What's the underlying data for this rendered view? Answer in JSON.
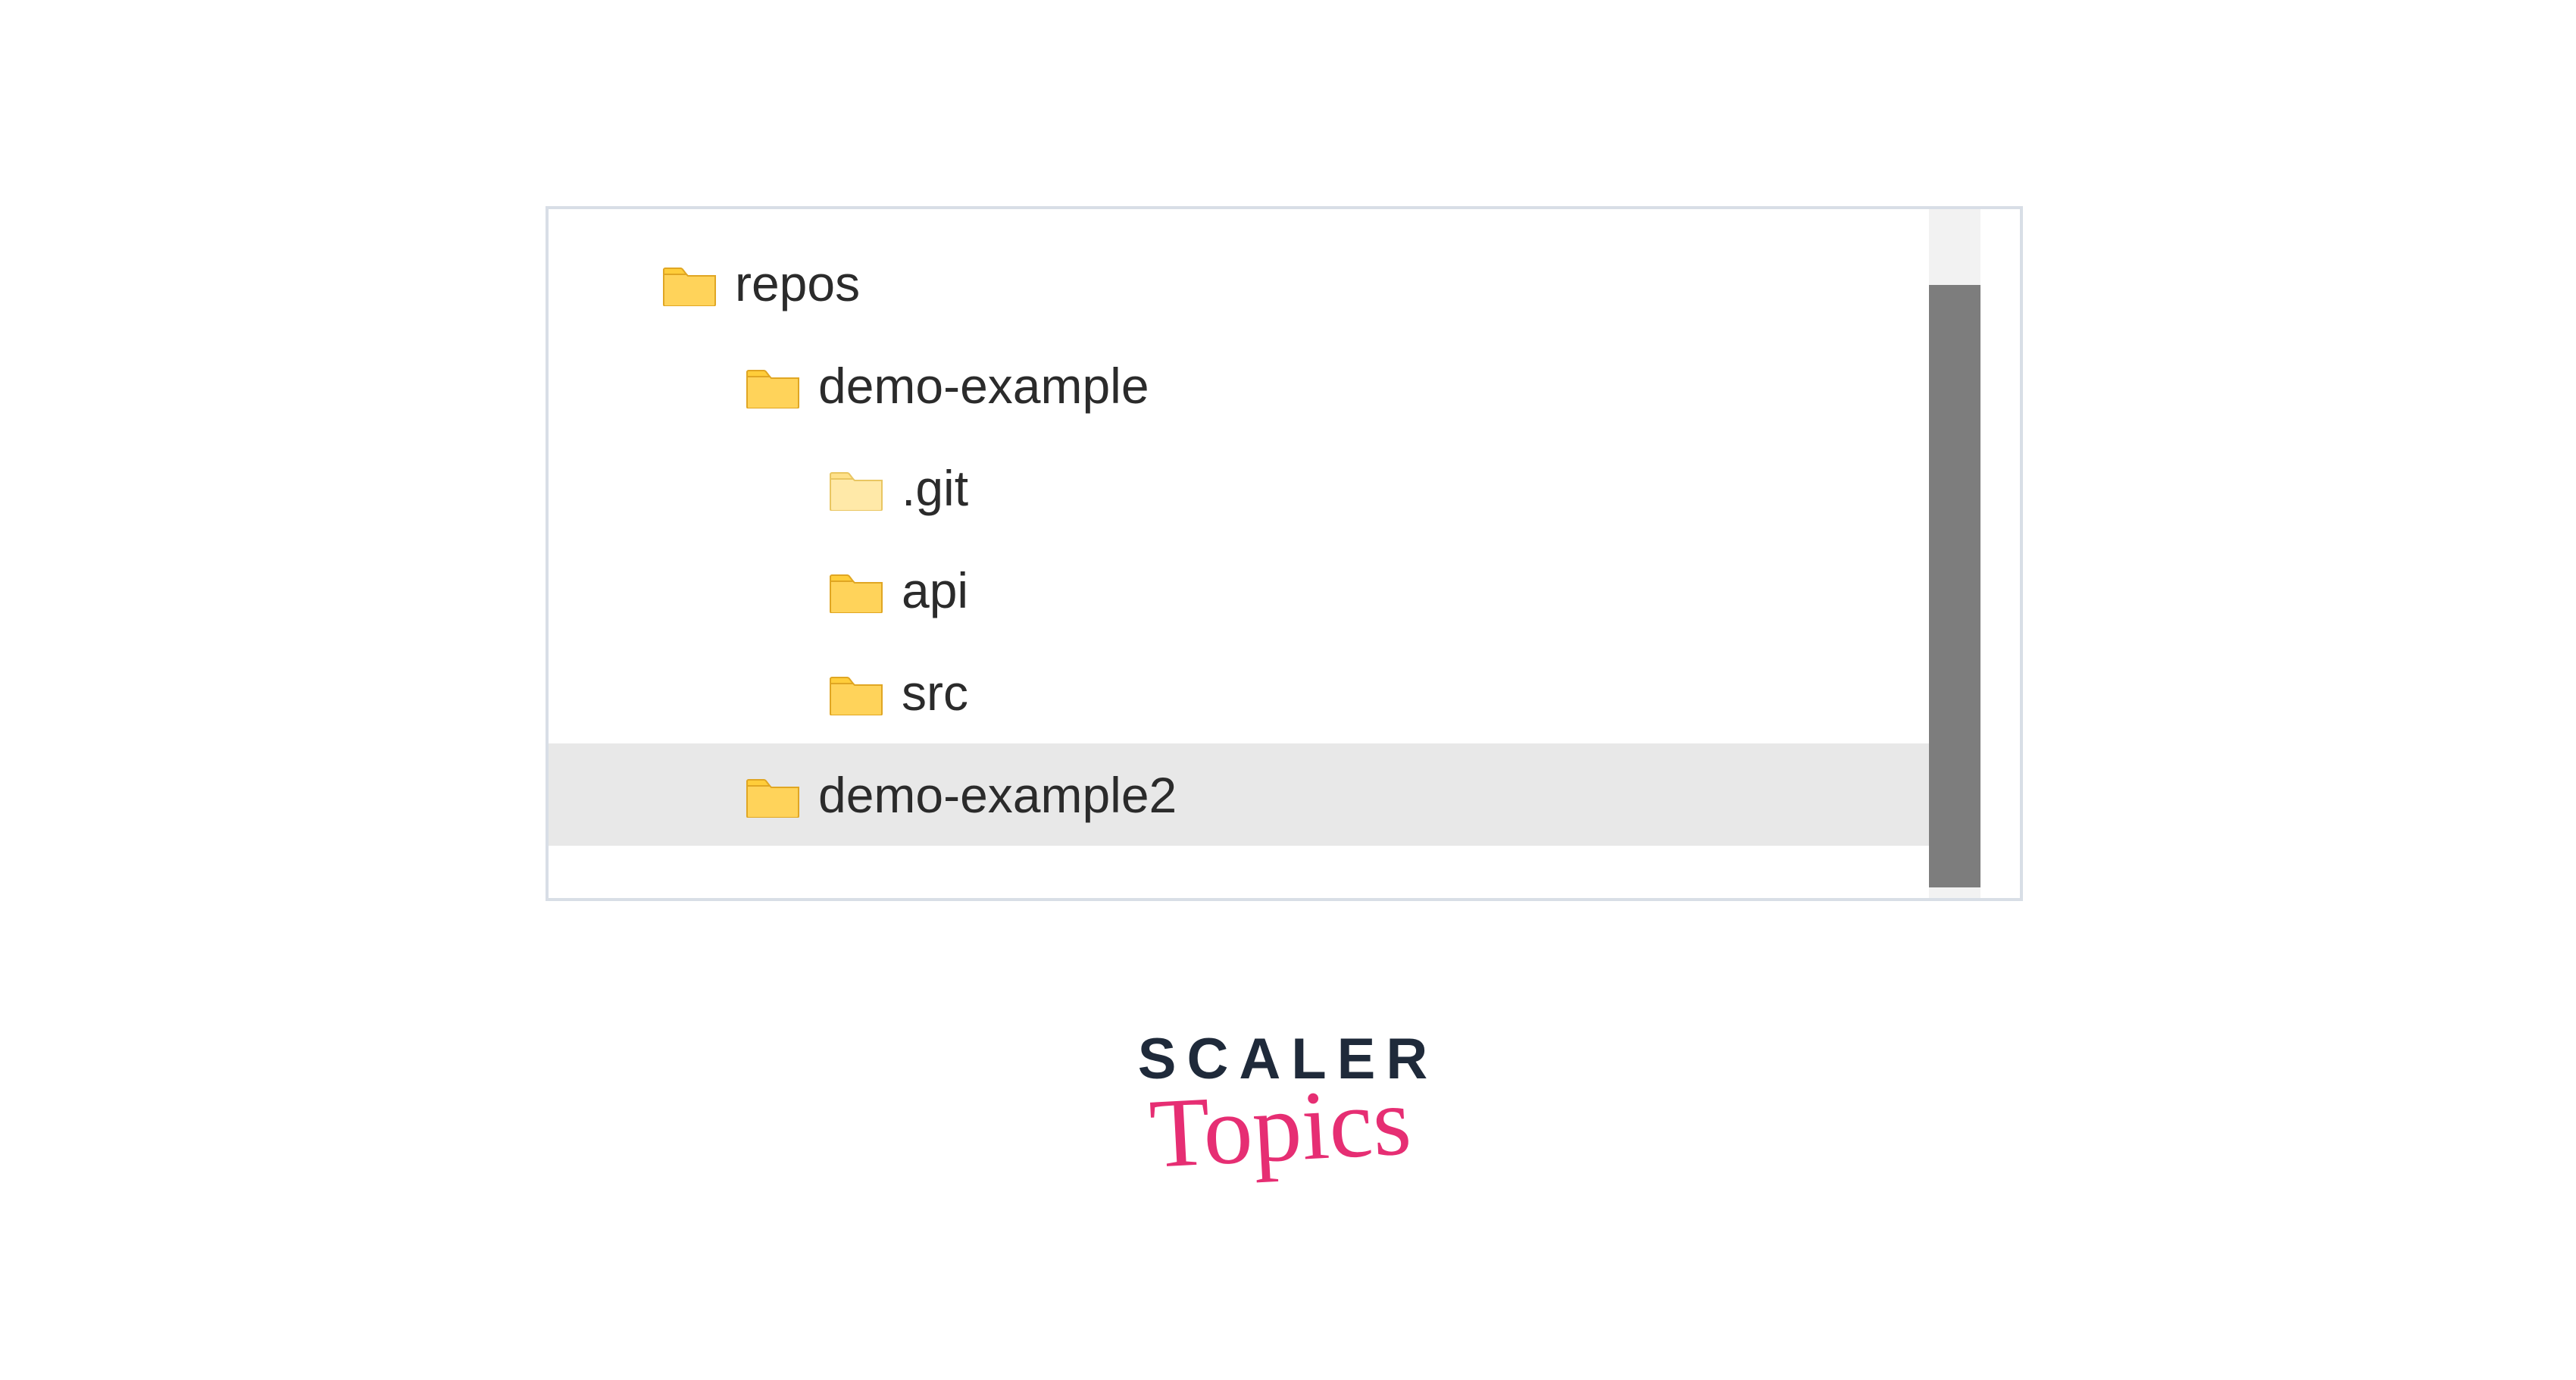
{
  "tree": {
    "rows": [
      {
        "label": "repos",
        "indent": 0,
        "icon": "folder",
        "selected": false
      },
      {
        "label": "demo-example",
        "indent": 1,
        "icon": "folder",
        "selected": false
      },
      {
        "label": ".git",
        "indent": 2,
        "icon": "folder-light",
        "selected": false
      },
      {
        "label": "api",
        "indent": 2,
        "icon": "folder",
        "selected": false
      },
      {
        "label": "src",
        "indent": 2,
        "icon": "folder",
        "selected": false
      },
      {
        "label": "demo-example2",
        "indent": 1,
        "icon": "folder",
        "selected": true
      }
    ]
  },
  "branding": {
    "line1": "SCALER",
    "line2": "Topics"
  },
  "icons": {
    "folder": "folder-icon",
    "folder-light": "folder-icon-light"
  }
}
